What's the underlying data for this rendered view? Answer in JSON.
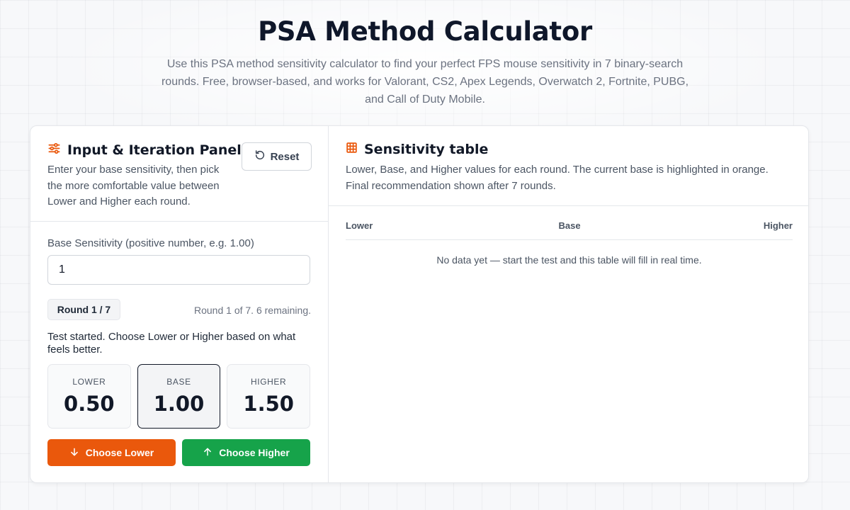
{
  "hero": {
    "title": "PSA Method Calculator",
    "description": "Use this PSA method sensitivity calculator to find your perfect FPS mouse sensitivity in 7 binary-search rounds. Free, browser-based, and works for Valorant, CS2, Apex Legends, Overwatch 2, Fortnite, PUBG, and Call of Duty Mobile."
  },
  "input_panel": {
    "title": "Input & Iteration Panel",
    "description": "Enter your base sensitivity, then pick the more comfortable value between Lower and Higher each round.",
    "reset_label": "Reset",
    "field_label": "Base Sensitivity (positive number, e.g. 1.00)",
    "field_value": "1",
    "round_badge": "Round 1 / 7",
    "round_note": "Round 1 of 7. 6 remaining.",
    "status": "Test started. Choose Lower or Higher based on what feels better.",
    "values": {
      "lower_label": "LOWER",
      "lower": "0.50",
      "base_label": "BASE",
      "base": "1.00",
      "higher_label": "HIGHER",
      "higher": "1.50"
    },
    "choose_lower_label": "Choose Lower",
    "choose_higher_label": "Choose Higher"
  },
  "table_panel": {
    "title": "Sensitivity table",
    "description": "Lower, Base, and Higher values for each round. The current base is highlighted in orange. Final recommendation shown after 7 rounds.",
    "columns": [
      "Lower",
      "Base",
      "Higher"
    ],
    "empty_message": "No data yet — start the test and this table will fill in real time."
  },
  "colors": {
    "accent_orange": "#ea580c",
    "accent_green": "#16a34a"
  },
  "icons": {
    "panel_icon": "sliders-icon",
    "table_icon": "table-grid-icon",
    "reset_icon": "rotate-ccw-icon",
    "lower_icon": "arrow-down-icon",
    "higher_icon": "arrow-up-icon"
  }
}
